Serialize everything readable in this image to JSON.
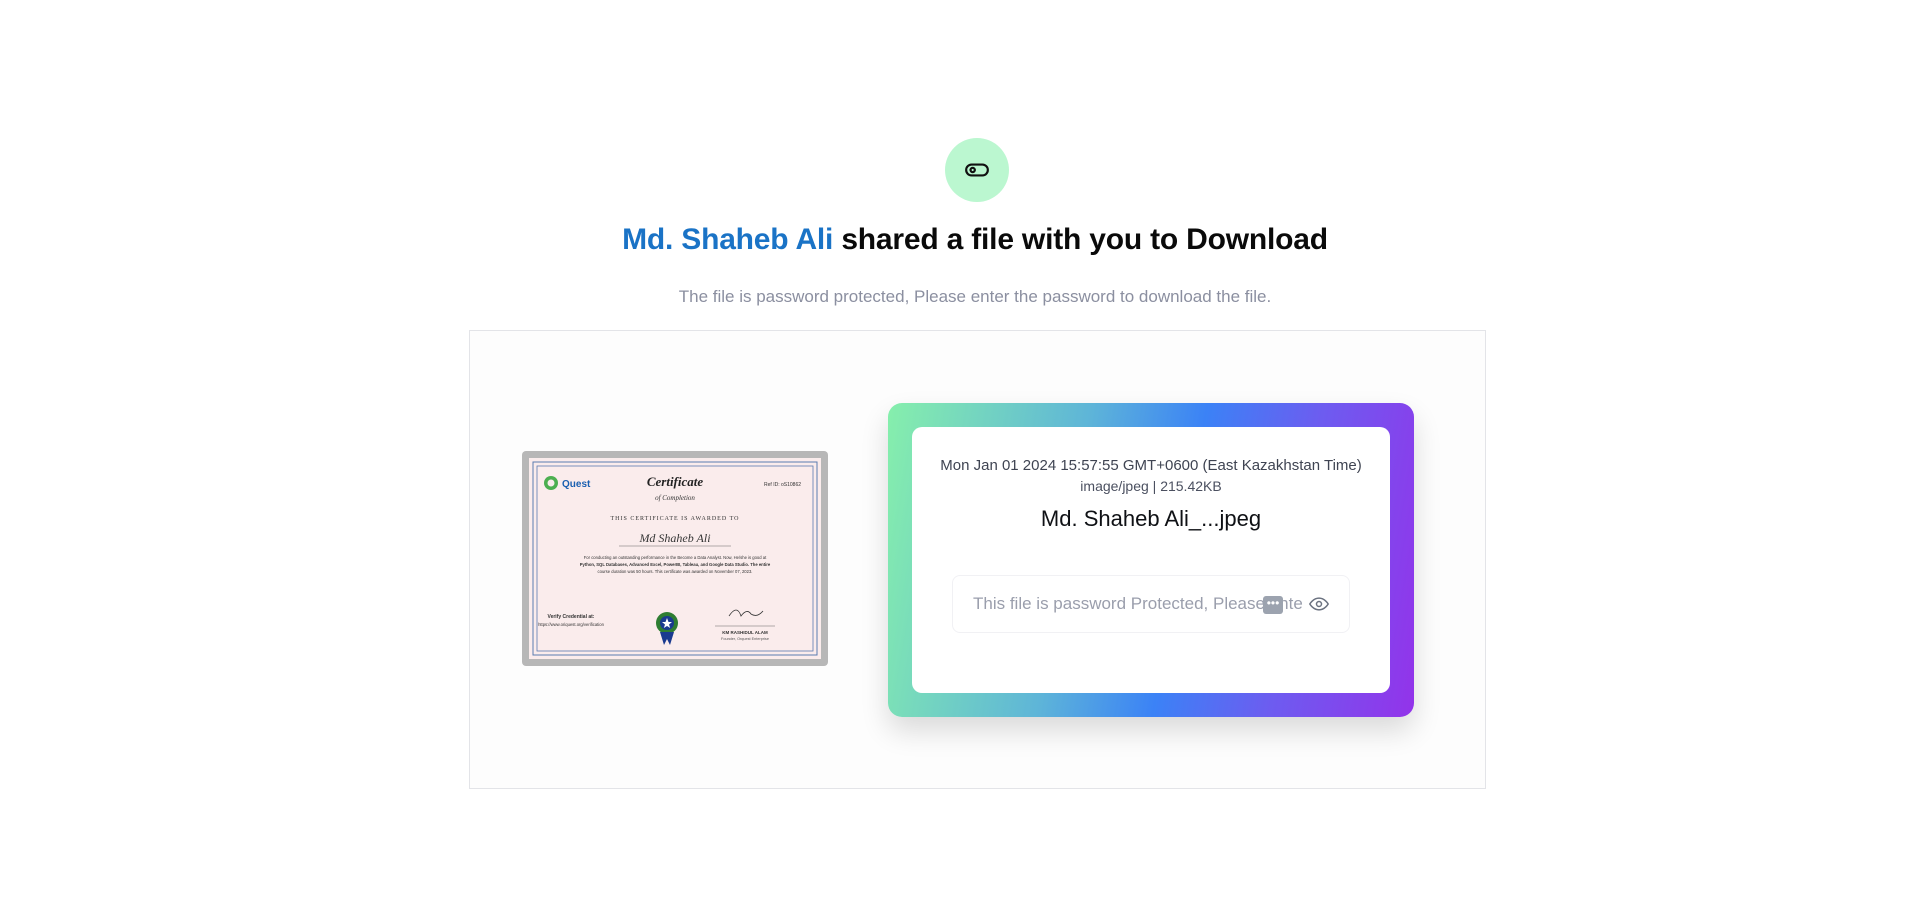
{
  "header": {
    "icon": "toggle-icon",
    "sender_name": "Md. Shaheb Ali",
    "headline_rest": " shared a file with you to Download",
    "subtitle": "The file is password protected, Please enter the password to download the file."
  },
  "file": {
    "date": "Mon Jan 01 2024 15:57:55 GMT+0600 (East Kazakhstan Time)",
    "type_size": "image/jpeg | 215.42KB",
    "name": "Md. Shaheb Ali_...jpeg"
  },
  "password": {
    "placeholder": "This file is password Protected, Please enter password",
    "value": "",
    "toggle_icon": "eye-icon",
    "hint_badge": "•••"
  },
  "preview": {
    "brand": "Quest",
    "title": "Certificate",
    "subtitle": "of Completion",
    "ref": "Ref ID: oS10862",
    "awarded_to": "THIS CERTIFICATE IS AWARDED TO",
    "recipient": "Md Shaheb Ali",
    "body_line1": "For conducting an outstanding performance in the Become a Data Analyst. Now, He/she is good at",
    "body_line2": "Python, SQL Databases, Advanced Excel, PowerBI, Tableau, and Google Data Studio. The entire",
    "body_line3": "course duration was 50 hours. This certificate was awarded on November 07, 2023.",
    "verify_label": "Verify Credential at:",
    "verify_url": "https://www.oriquest.org/verification",
    "signer": "KM RASHIDUL ALAM",
    "signer_role": "Founder, Orquest Enterprise"
  },
  "colors": {
    "accent": "#1a73c6",
    "icon_bg": "#bbf7d0",
    "gradient": [
      "#86efac",
      "#3b82f6",
      "#9333ea"
    ]
  }
}
